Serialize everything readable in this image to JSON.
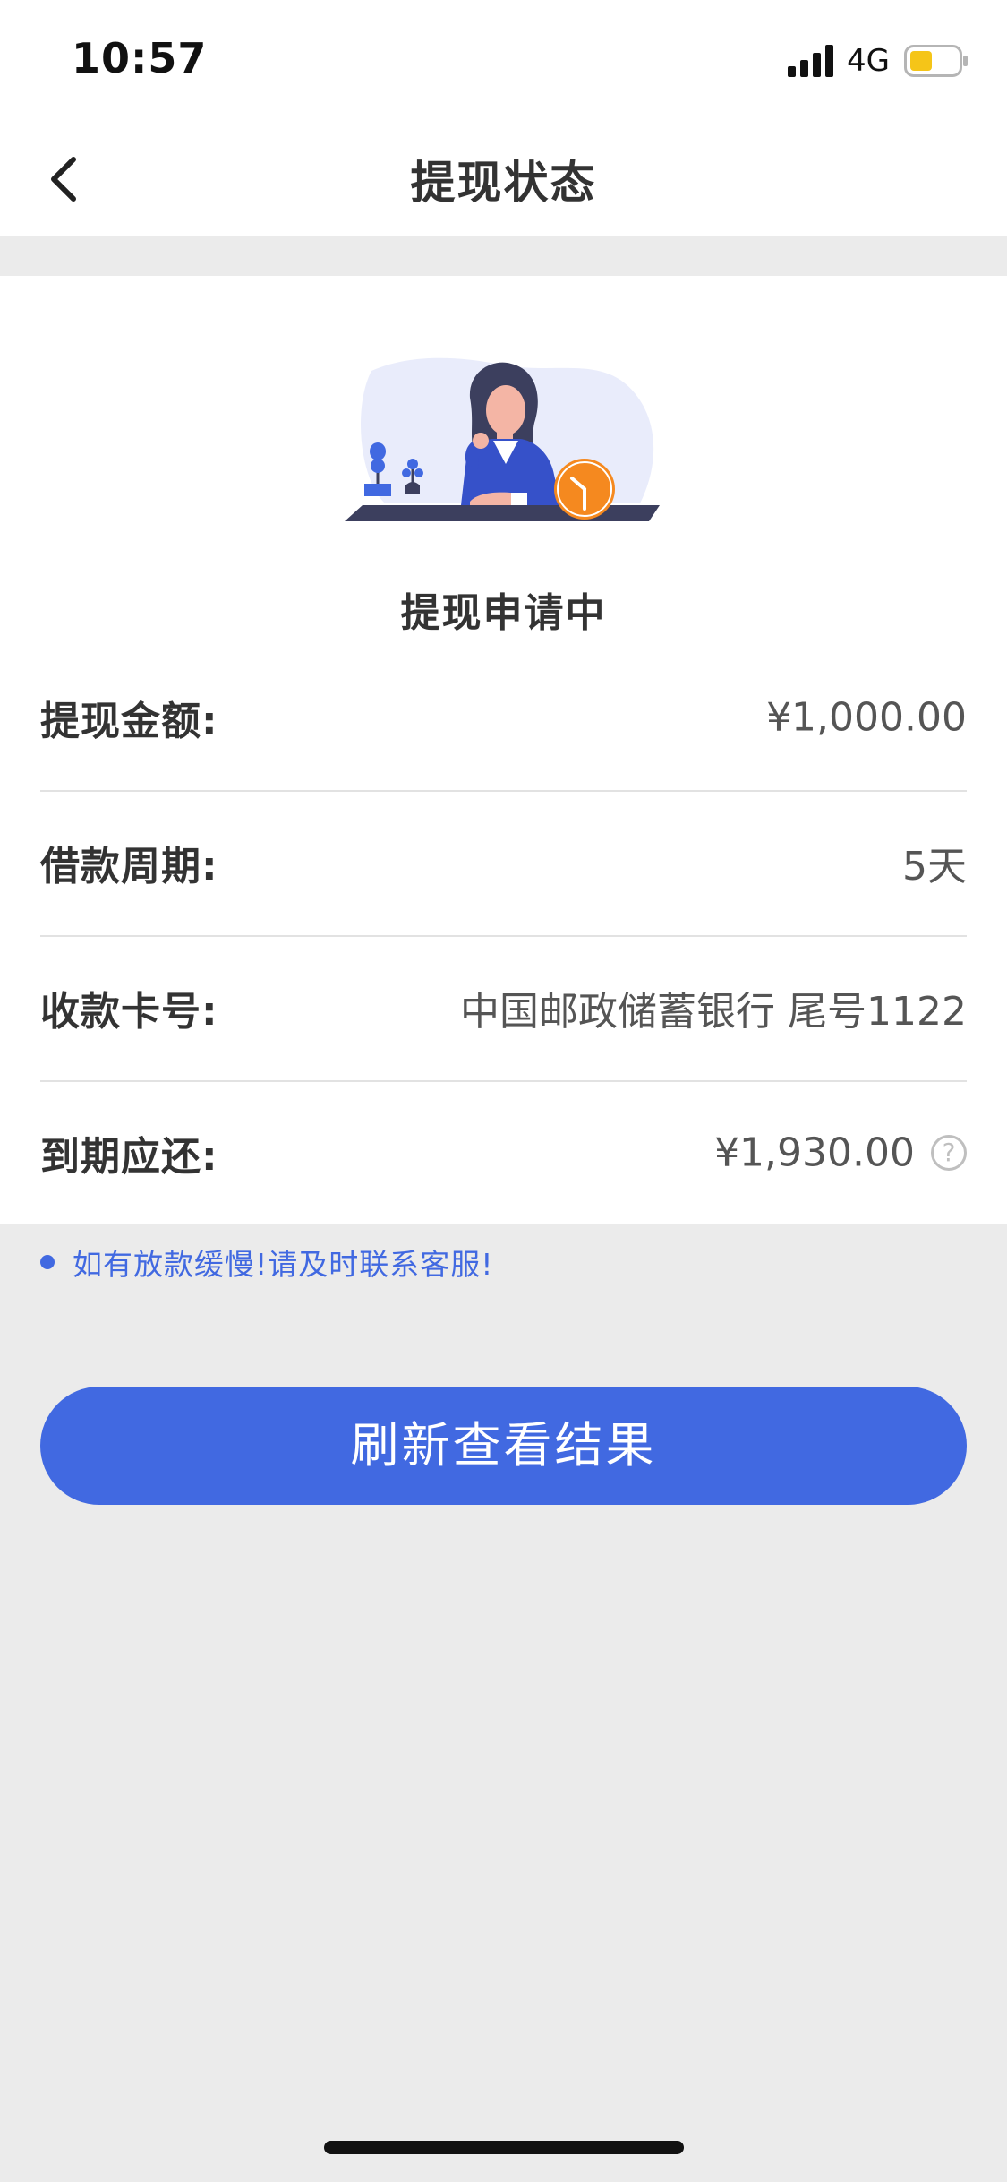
{
  "status_bar": {
    "time": "10:57",
    "network": "4G",
    "battery_color": "#f5c518"
  },
  "nav": {
    "title": "提现状态",
    "back_icon": "chevron-left-icon"
  },
  "status": {
    "heading": "提现申请中",
    "illustration": "woman-waiting-with-clock-illustration"
  },
  "details": [
    {
      "label": "提现金额:",
      "value": "¥1,000.00"
    },
    {
      "label": "借款周期:",
      "value": "5天"
    },
    {
      "label": "收款卡号:",
      "value": "中国邮政储蓄银行 尾号1122"
    },
    {
      "label": "到期应还:",
      "value": "¥1,930.00",
      "help_icon": "question-circle-icon"
    }
  ],
  "notice": {
    "text": "如有放款缓慢!请及时联系客服!"
  },
  "button": {
    "label": "刷新查看结果"
  },
  "colors": {
    "accent": "#4169e1",
    "background": "#ebebeb",
    "clock_orange": "#f5891f"
  }
}
